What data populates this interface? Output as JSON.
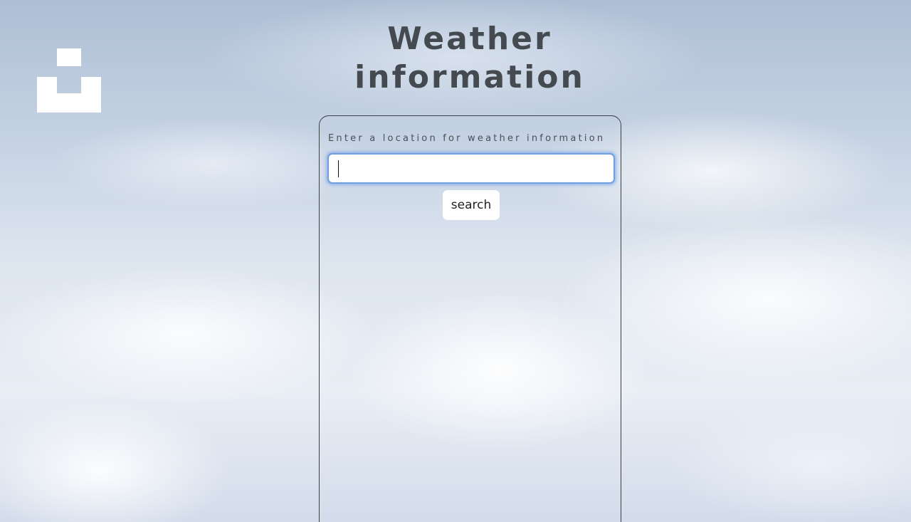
{
  "header": {
    "title": "Weather information"
  },
  "logo": {
    "icon": "unsplash-logo-icon",
    "color": "#ffffff"
  },
  "search": {
    "prompt": "Enter a location for weather information",
    "value": "",
    "placeholder": "",
    "button_label": "search"
  },
  "colors": {
    "title_text": "#454a50",
    "panel_border": "#3b3f46",
    "input_focus_ring": "#6e9fe0"
  }
}
